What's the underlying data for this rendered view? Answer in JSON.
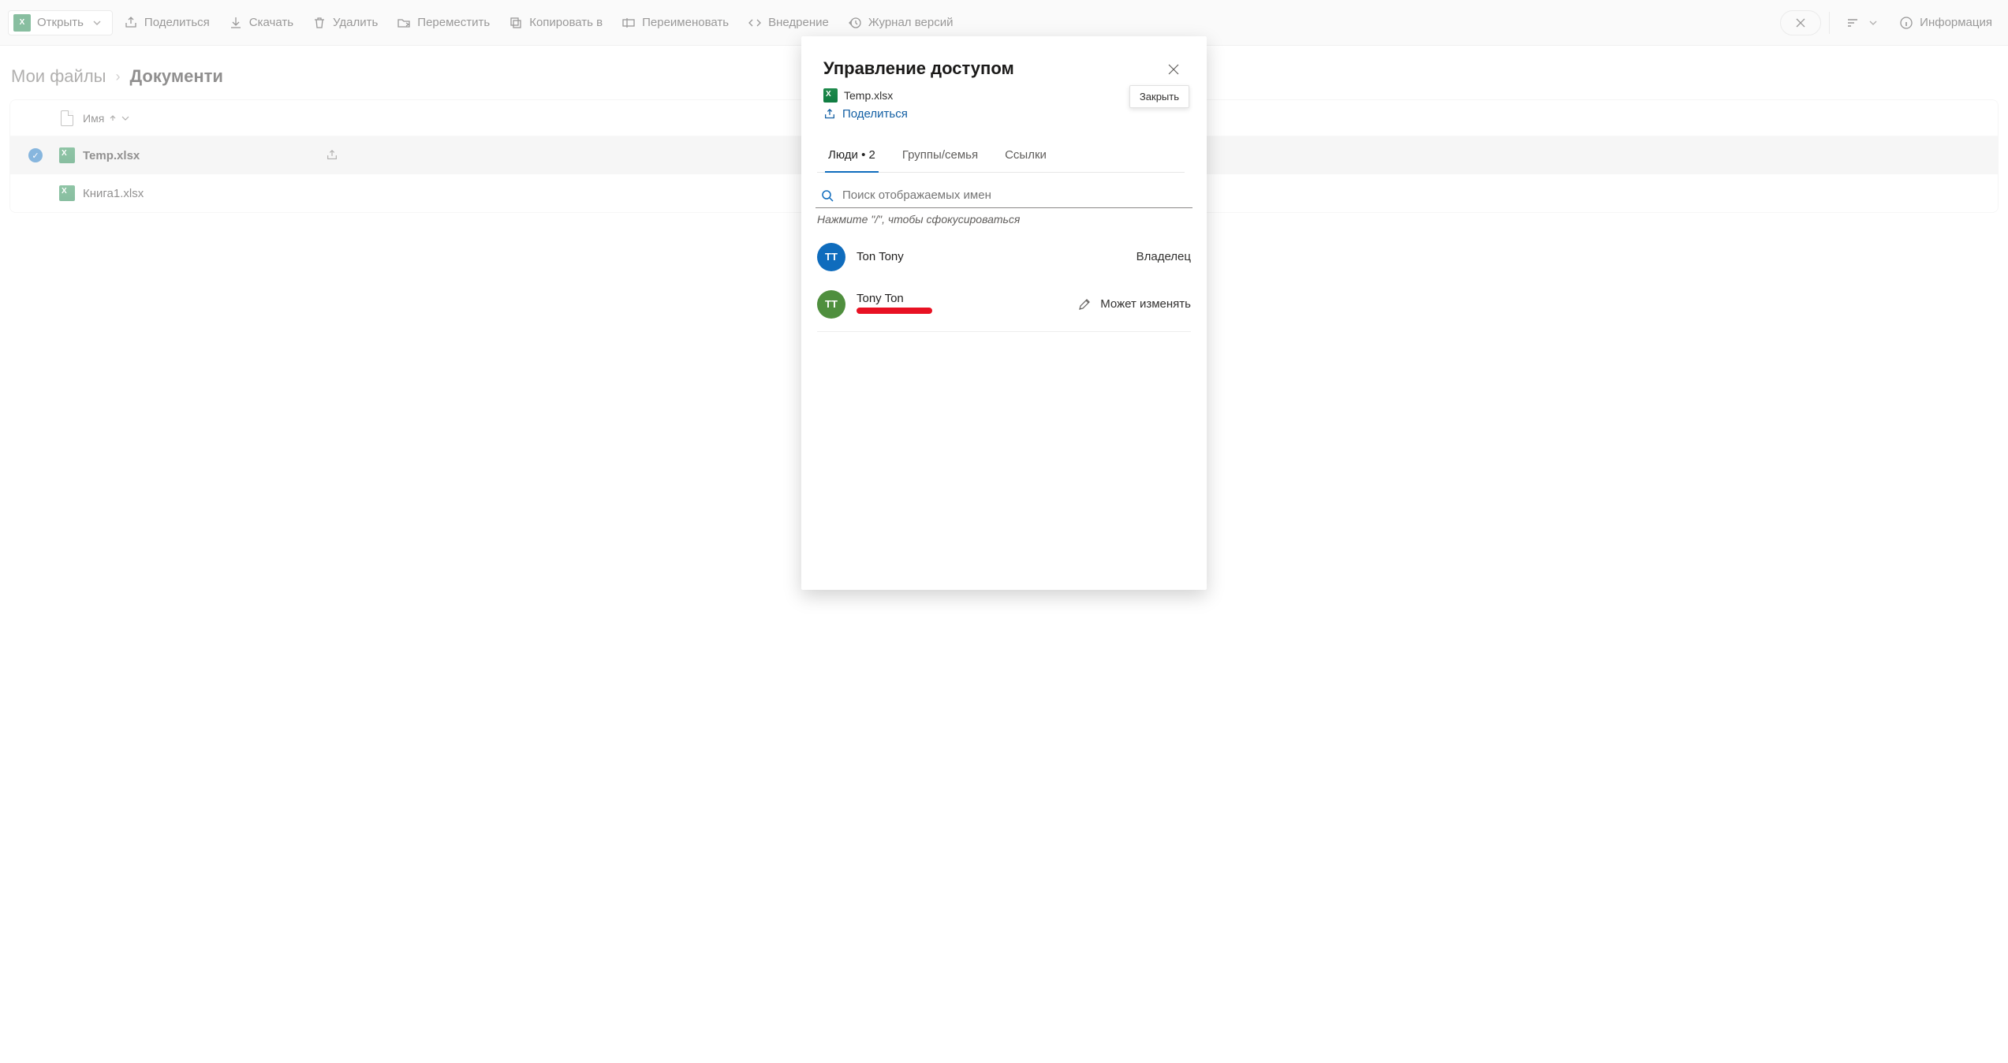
{
  "toolbar": {
    "open_label": "Открыть",
    "share_label": "Поделиться",
    "download_label": "Скачать",
    "delete_label": "Удалить",
    "move_label": "Переместить",
    "copy_label": "Копировать в",
    "rename_label": "Переименовать",
    "embed_label": "Внедрение",
    "versions_label": "Журнал версий",
    "info_label": "Информация"
  },
  "breadcrumbs": {
    "root": "Мои файлы",
    "current": "Документи"
  },
  "file_table": {
    "name_header": "Имя",
    "rows": [
      {
        "name": "Temp.xlsx",
        "selected": true,
        "shared": true
      },
      {
        "name": "Книга1.xlsx",
        "selected": false,
        "shared": false
      }
    ]
  },
  "dialog": {
    "title": "Управление доступом",
    "file_name": "Temp.xlsx",
    "share_action": "Поделиться",
    "close_tooltip": "Закрыть",
    "tabs": {
      "people": "Люди",
      "people_count": "2",
      "groups": "Группы/семья",
      "links": "Ссылки"
    },
    "search_placeholder": "Поиск отображаемых имен",
    "search_hint": "Нажмите \"/\", чтобы сфокусироваться",
    "people": [
      {
        "initials": "TT",
        "name": "Ton Tony",
        "role": "Владелец",
        "avatar_color": "blue"
      },
      {
        "initials": "TT",
        "name": "Tony Ton",
        "role": "Может изменять",
        "avatar_color": "green",
        "editable": true,
        "email_redacted": true
      }
    ]
  }
}
